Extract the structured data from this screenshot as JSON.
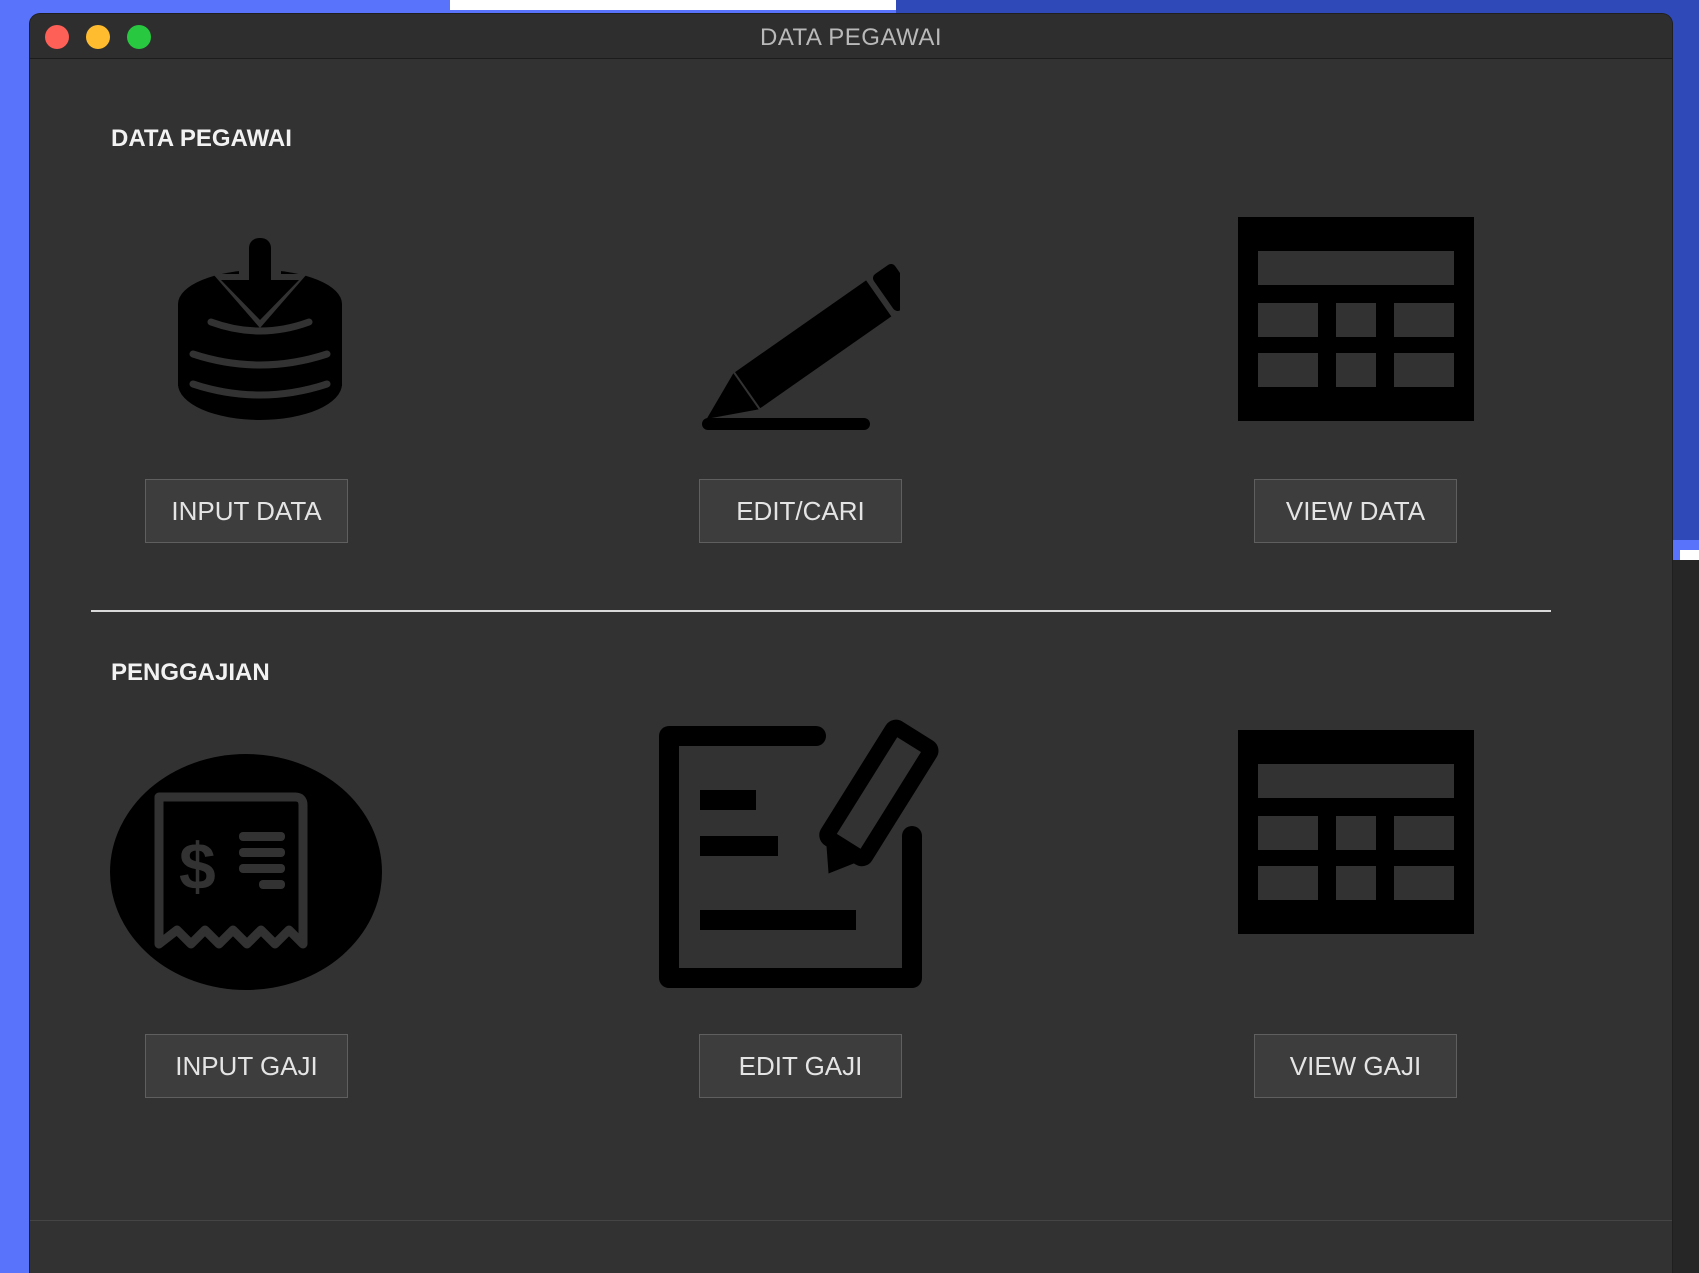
{
  "window": {
    "title": "DATA PEGAWAI"
  },
  "sections": {
    "pegawai": {
      "label": "DATA PEGAWAI",
      "input_button": "INPUT DATA",
      "edit_button": "EDIT/CARI",
      "view_button": "VIEW DATA"
    },
    "gaji": {
      "label": "PENGGAJIAN",
      "input_button": "INPUT GAJI",
      "edit_button": "EDIT GAJI",
      "view_button": "VIEW GAJI"
    }
  },
  "icons": {
    "input_data": "database-download-icon",
    "edit_data": "pencil-icon",
    "view_data": "table-icon",
    "input_gaji": "receipt-dollar-icon",
    "edit_gaji": "document-edit-icon",
    "view_gaji": "table-icon"
  },
  "colors": {
    "window_bg": "#323232",
    "titlebar_bg": "#2e2e2e",
    "button_bg": "#3d3d3d",
    "close": "#fe5f57",
    "minimize": "#febc2e",
    "maximize": "#28c840"
  }
}
